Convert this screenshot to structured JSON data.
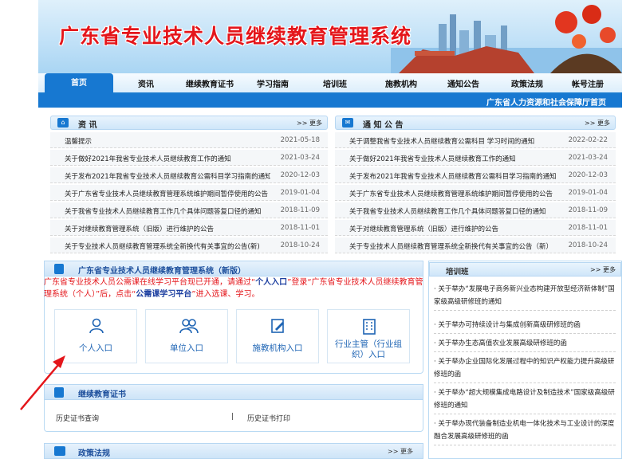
{
  "header": {
    "title": "广东省专业技术人员继续教育管理系统"
  },
  "nav": {
    "items": [
      "首页",
      "资讯",
      "继续教育证书",
      "学习指南",
      "培训班",
      "施教机构",
      "通知公告",
      "政策法规",
      "帐号注册"
    ]
  },
  "subbar": {
    "text": "广东省人力资源和社会保障厅首页"
  },
  "news": {
    "title": "资  讯",
    "more": ">> 更多",
    "items": [
      {
        "title": "温馨提示",
        "date": "2021-05-18"
      },
      {
        "title": "关于做好2021年我省专业技术人员继续教育工作的通知",
        "date": "2021-03-24"
      },
      {
        "title": "关于发布2021年我省专业技术人员继续教育公需科目学习指南的通知",
        "date": "2020-12-03"
      },
      {
        "title": "关于广东省专业技术人员继续教育管理系统维护期间暂停使用的公告",
        "date": "2019-01-04"
      },
      {
        "title": "关于我省专业技术人员继续教育工作几个具体问题答复口径的通知",
        "date": "2018-11-09"
      },
      {
        "title": "关于对继续教育管理系统（旧版）进行维护的公告",
        "date": "2018-11-01"
      },
      {
        "title": "关于专业技术人员继续教育管理系统全新换代有关事宜的公告(新)",
        "date": "2018-10-24"
      }
    ]
  },
  "notices": {
    "title": "通 知 公 告",
    "more": ">> 更多",
    "items": [
      {
        "title": "关于调整我省专业技术人员继续教育公需科目 学习时间的通知",
        "date": "2022-02-22"
      },
      {
        "title": "关于做好2021年我省专业技术人员继续教育工作的通知",
        "date": "2021-03-24"
      },
      {
        "title": "关于发布2021年我省专业技术人员继续教育公需科目学习指南的通知",
        "date": "2020-12-03"
      },
      {
        "title": "关于广东省专业技术人员继续教育管理系统维护期间暂停使用的公告",
        "date": "2019-01-04"
      },
      {
        "title": "关于我省专业技术人员继续教育工作几个具体问题答复口径的通知",
        "date": "2018-11-09"
      },
      {
        "title": "关于对继续教育管理系统（旧版）进行维护的公告",
        "date": "2018-11-01"
      },
      {
        "title": "关于专业技术人员继续教育管理系统全新换代有关事宜的公告（新）",
        "date": "2018-10-24"
      }
    ]
  },
  "system": {
    "title": "广东省专业技术人员继续教育管理系统（新版）",
    "notice_a": "广东省专业技术人员公需课在线学习平台现已开通，请通过“",
    "notice_b": "个人入口",
    "notice_c": "”登录“广东省专业技术人员继续教育管理系统（个人）”后，点击“",
    "notice_d": "公需课学习平台",
    "notice_e": "”进入选课、学习。",
    "entries": [
      "个人入口",
      "单位入口",
      "施教机构入口",
      "行业主管（行业组织）入口"
    ]
  },
  "cert": {
    "title": "继续教育证书",
    "query": "历史证书查询",
    "sep": "|",
    "print": "历史证书打印"
  },
  "policy": {
    "title": "政策法规",
    "more": ">> 更多"
  },
  "training": {
    "title": "培训班",
    "more": ">> 更多",
    "items": [
      "· 关于举办“发展电子商务新兴业态构建开放型经济新体制”国家级高级研修班的通知",
      "· 关于举办可持续设计与集成创新高级研修班的函",
      "· 关于举办生态高值农业发展高级研修班的函",
      "· 关于举办企业国际化发展过程中的知识产权能力提升高级研修班的函",
      "· 关于举办“超大规模集成电路设计及制造技术”国家级高级研修班的通知",
      "· 关于举办现代装备制造业机电一体化技术与工业设计的深度融合发展高级研修班的函"
    ]
  },
  "colors": {
    "brand": "#1778d1",
    "title_red": "#e4161b"
  }
}
